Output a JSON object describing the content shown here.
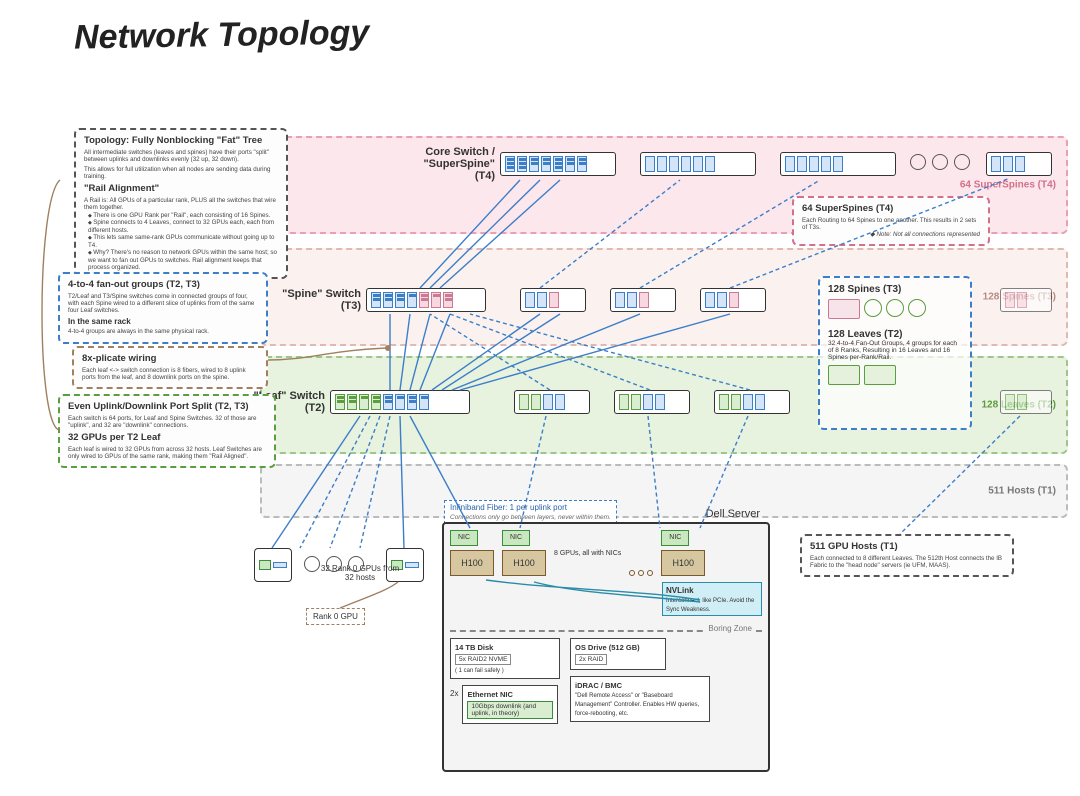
{
  "title": "Network Topology",
  "tier_labels": {
    "t4": "64 SuperSpines (T4)",
    "t3": "128 Spines (T3)",
    "t2": "128 Leaves (T2)",
    "t1": "511 Hosts (T1)"
  },
  "switches": {
    "core": {
      "label": "Core Switch / \"SuperSpine\" (T4)"
    },
    "spine": {
      "label": "\"Spine\" Switch (T3)"
    },
    "leaf": {
      "label": "\"Leaf\" Switch (T2)"
    }
  },
  "callouts": {
    "topology": {
      "title": "Topology: Fully Nonblocking \"Fat\" Tree",
      "line1": "All intermediate switches (leaves and spines) have their ports \"split\" between uplinks and downlinks evenly (32 up, 32 down).",
      "line2": "This allows for full utilization when all nodes are sending data during training.",
      "rail_title": "\"Rail Alignment\"",
      "rail_intro": "A Rail is: All GPUs of a particular rank, PLUS all the switches that wire them together.",
      "rail_bullets": [
        "There is one GPU Rank per \"Rail\", each consisting of 16 Spines.",
        "Spine connects to 4 Leaves, connect to 32 GPUs each, each from different hosts.",
        "This lets same same-rank GPUs communicate without going up to T4.",
        "Why? There's no reason to network GPUs within the same host; so we want to fan out GPUs to switches. Rail alignment keeps that process organized."
      ]
    },
    "fanout": {
      "title": "4-to-4 fan-out groups (T2, T3)",
      "line1": "T2/Leaf and T3/Spine switches come in connected groups of four, with each Spine wired to a different slice of uplinks from of the same four Leaf switches.",
      "line2_title": "In the same rack",
      "line2": "4-to-4 groups are always in the same physical rack."
    },
    "eight_plicate": {
      "title": "8x-plicate wiring",
      "line1": "Each leaf <-> switch connection is 8 fibers, wired to 8 uplink ports from the leaf, and 8 downlink ports on the spine."
    },
    "port_split": {
      "title1": "Even Uplink/Downlink Port Split (T2, T3)",
      "line1": "Each switch is 64 ports, for Leaf and Spine Switches. 32 of those are \"uplink\", and 32 are \"downlink\" connections.",
      "title2": "32 GPUs per T2 Leaf",
      "line2": "Each leaf is wired to 32 GPUs from across 32 hosts. Leaf Switches are only wired to GPUs of the same rank, making them \"Rail Aligned\"."
    },
    "superspines": {
      "title": "64 SuperSpines (T4)",
      "body": "Each Routing to 64 Spines to one another. This results in 2 sets of T3s.",
      "note": "◆ Note: Not all connections represented"
    },
    "hosts": {
      "title": "511 GPU Hosts (T1)",
      "body": "Each connected to 8 different Leaves. The 512th Host connects the IB Fabric to the \"head node\" servers (ie UFM, MAAS)."
    },
    "groups_detail": {
      "spines_title": "128 Spines (T3)",
      "leaves_title": "128 Leaves (T2)",
      "leaves_body": "32 4-to-4 Fan-Out Groups, 4 groups for each of 8 Ranks, Resulting in 16 Leaves and 16 Spines per-Rank/Rail."
    }
  },
  "ib_fiber": {
    "title": "Infiniband Fiber: 1 per uplink port",
    "sub": "Connections only go between layers, never within them."
  },
  "server": {
    "label": "Dell Server",
    "nic": "NIC",
    "gpu": "H100",
    "gpu_note": "8 GPUs, all with NICs",
    "nvlink_title": "NVLink",
    "nvlink_body": "Interconnect, like PCIe. Avoid the Sync Weakness.",
    "boring": "Boring Zone",
    "disk_title": "14 TB Disk",
    "disk_sub": "5x  RAID2 NVME",
    "disk_note": "( 1 can fail safely )",
    "os_title": "OS Drive (512 GB)",
    "os_sub": "2x  RAID",
    "eth_prefix": "2x",
    "eth_title": "Ethernet NIC",
    "eth_sub": "10Gbps downlink (and uplink, in theory)",
    "idrac_title": "iDRAC / BMC",
    "idrac_body": "\"Dell Remote Access\" or \"Baseboard Management\" Controller. Enables HW queries, force-rebooting, etc."
  },
  "rank0": {
    "label": "Rank 0 GPU",
    "caption": "32 Rank 0 GPUs from 32 hosts"
  },
  "chart_data": {
    "type": "diagram",
    "tree": {
      "T4_super_spines": 64,
      "T3_spines": 128,
      "T2_leaves": 128,
      "T1_hosts": 511,
      "reserved_head_node_host": 1
    },
    "switch_ports": {
      "total": 64,
      "uplink": 32,
      "downlink": 32
    },
    "leaf_to_spine_fibers_per_link": 8,
    "gpus_per_leaf": 32,
    "fan_out_group_size": 4,
    "fan_out_groups_total": 32,
    "fan_out_groups_per_rank": 4,
    "ranks": 8,
    "leaves_per_rail": 16,
    "spines_per_rail": 16,
    "host": {
      "gpus": 8,
      "gpu_model": "H100",
      "disk_tb": 14,
      "disk_config": "5x RAID2 NVME",
      "os_drive_gb": 512,
      "os_drive_config": "2x RAID",
      "eth_nics": 2,
      "eth_speed_gbps": 10,
      "gpu_interconnect": "NVLink",
      "management": "iDRAC / BMC"
    }
  }
}
